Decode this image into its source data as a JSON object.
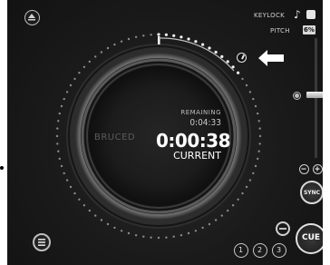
{
  "deck": {
    "track_title": "BRUCED",
    "remaining_label": "REMAINING",
    "remaining_time": "0:04:33",
    "current_time": "0:00:38",
    "current_label": "CURRENT"
  },
  "controls": {
    "keylock_label": "KEYLOCK",
    "pitch_label": "PITCH",
    "pitch_value": "6%",
    "sync_label": "SYNC",
    "cue_label": "CUE",
    "hotcues": [
      "1",
      "2",
      "3"
    ]
  },
  "icons": {
    "eject": "eject-icon",
    "menu": "menu-icon",
    "keylock": "music-note-icon",
    "arrow": "left-arrow-icon"
  },
  "colors": {
    "background": "#1a1a1a",
    "platter": "#2b2b2b",
    "ring_dots": "#e6e6e6",
    "text": "#ffffff"
  }
}
